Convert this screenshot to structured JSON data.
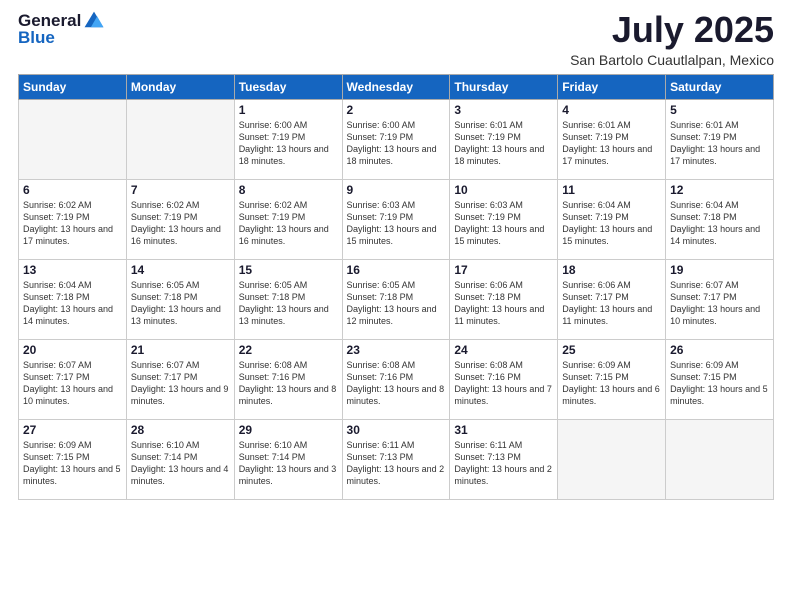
{
  "header": {
    "logo_general": "General",
    "logo_blue": "Blue",
    "month_year": "July 2025",
    "location": "San Bartolo Cuautlalpan, Mexico"
  },
  "weekdays": [
    "Sunday",
    "Monday",
    "Tuesday",
    "Wednesday",
    "Thursday",
    "Friday",
    "Saturday"
  ],
  "weeks": [
    [
      {
        "day": "",
        "info": ""
      },
      {
        "day": "",
        "info": ""
      },
      {
        "day": "1",
        "info": "Sunrise: 6:00 AM\nSunset: 7:19 PM\nDaylight: 13 hours and 18 minutes."
      },
      {
        "day": "2",
        "info": "Sunrise: 6:00 AM\nSunset: 7:19 PM\nDaylight: 13 hours and 18 minutes."
      },
      {
        "day": "3",
        "info": "Sunrise: 6:01 AM\nSunset: 7:19 PM\nDaylight: 13 hours and 18 minutes."
      },
      {
        "day": "4",
        "info": "Sunrise: 6:01 AM\nSunset: 7:19 PM\nDaylight: 13 hours and 17 minutes."
      },
      {
        "day": "5",
        "info": "Sunrise: 6:01 AM\nSunset: 7:19 PM\nDaylight: 13 hours and 17 minutes."
      }
    ],
    [
      {
        "day": "6",
        "info": "Sunrise: 6:02 AM\nSunset: 7:19 PM\nDaylight: 13 hours and 17 minutes."
      },
      {
        "day": "7",
        "info": "Sunrise: 6:02 AM\nSunset: 7:19 PM\nDaylight: 13 hours and 16 minutes."
      },
      {
        "day": "8",
        "info": "Sunrise: 6:02 AM\nSunset: 7:19 PM\nDaylight: 13 hours and 16 minutes."
      },
      {
        "day": "9",
        "info": "Sunrise: 6:03 AM\nSunset: 7:19 PM\nDaylight: 13 hours and 15 minutes."
      },
      {
        "day": "10",
        "info": "Sunrise: 6:03 AM\nSunset: 7:19 PM\nDaylight: 13 hours and 15 minutes."
      },
      {
        "day": "11",
        "info": "Sunrise: 6:04 AM\nSunset: 7:19 PM\nDaylight: 13 hours and 15 minutes."
      },
      {
        "day": "12",
        "info": "Sunrise: 6:04 AM\nSunset: 7:18 PM\nDaylight: 13 hours and 14 minutes."
      }
    ],
    [
      {
        "day": "13",
        "info": "Sunrise: 6:04 AM\nSunset: 7:18 PM\nDaylight: 13 hours and 14 minutes."
      },
      {
        "day": "14",
        "info": "Sunrise: 6:05 AM\nSunset: 7:18 PM\nDaylight: 13 hours and 13 minutes."
      },
      {
        "day": "15",
        "info": "Sunrise: 6:05 AM\nSunset: 7:18 PM\nDaylight: 13 hours and 13 minutes."
      },
      {
        "day": "16",
        "info": "Sunrise: 6:05 AM\nSunset: 7:18 PM\nDaylight: 13 hours and 12 minutes."
      },
      {
        "day": "17",
        "info": "Sunrise: 6:06 AM\nSunset: 7:18 PM\nDaylight: 13 hours and 11 minutes."
      },
      {
        "day": "18",
        "info": "Sunrise: 6:06 AM\nSunset: 7:17 PM\nDaylight: 13 hours and 11 minutes."
      },
      {
        "day": "19",
        "info": "Sunrise: 6:07 AM\nSunset: 7:17 PM\nDaylight: 13 hours and 10 minutes."
      }
    ],
    [
      {
        "day": "20",
        "info": "Sunrise: 6:07 AM\nSunset: 7:17 PM\nDaylight: 13 hours and 10 minutes."
      },
      {
        "day": "21",
        "info": "Sunrise: 6:07 AM\nSunset: 7:17 PM\nDaylight: 13 hours and 9 minutes."
      },
      {
        "day": "22",
        "info": "Sunrise: 6:08 AM\nSunset: 7:16 PM\nDaylight: 13 hours and 8 minutes."
      },
      {
        "day": "23",
        "info": "Sunrise: 6:08 AM\nSunset: 7:16 PM\nDaylight: 13 hours and 8 minutes."
      },
      {
        "day": "24",
        "info": "Sunrise: 6:08 AM\nSunset: 7:16 PM\nDaylight: 13 hours and 7 minutes."
      },
      {
        "day": "25",
        "info": "Sunrise: 6:09 AM\nSunset: 7:15 PM\nDaylight: 13 hours and 6 minutes."
      },
      {
        "day": "26",
        "info": "Sunrise: 6:09 AM\nSunset: 7:15 PM\nDaylight: 13 hours and 5 minutes."
      }
    ],
    [
      {
        "day": "27",
        "info": "Sunrise: 6:09 AM\nSunset: 7:15 PM\nDaylight: 13 hours and 5 minutes."
      },
      {
        "day": "28",
        "info": "Sunrise: 6:10 AM\nSunset: 7:14 PM\nDaylight: 13 hours and 4 minutes."
      },
      {
        "day": "29",
        "info": "Sunrise: 6:10 AM\nSunset: 7:14 PM\nDaylight: 13 hours and 3 minutes."
      },
      {
        "day": "30",
        "info": "Sunrise: 6:11 AM\nSunset: 7:13 PM\nDaylight: 13 hours and 2 minutes."
      },
      {
        "day": "31",
        "info": "Sunrise: 6:11 AM\nSunset: 7:13 PM\nDaylight: 13 hours and 2 minutes."
      },
      {
        "day": "",
        "info": ""
      },
      {
        "day": "",
        "info": ""
      }
    ]
  ]
}
